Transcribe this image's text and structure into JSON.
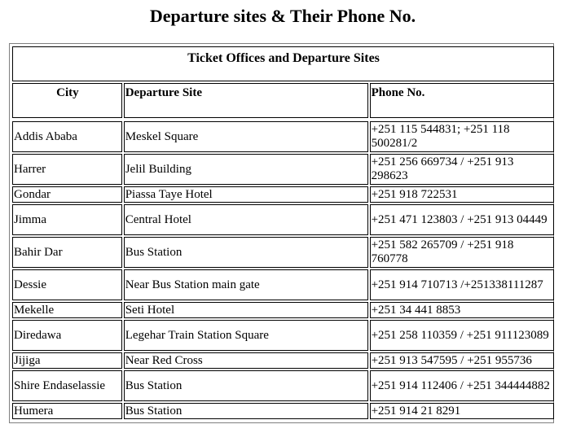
{
  "page": {
    "title": "Departure sites & Their Phone No."
  },
  "table": {
    "caption": "Ticket Offices and Departure Sites",
    "headers": {
      "city": "City",
      "site": "Departure Site",
      "phone": "Phone No."
    },
    "rows": [
      {
        "city": "Addis Ababa",
        "site": "Meskel Square",
        "phone": "+251 115 544831; +251 118 500281/2"
      },
      {
        "city": "Harrer",
        "site": "Jelil Building",
        "phone": "+251 256 669734 / +251 913 298623"
      },
      {
        "city": "Gondar",
        "site": "Piassa Taye Hotel",
        "phone": "+251 918 722531"
      },
      {
        "city": "Jimma",
        "site": "Central Hotel",
        "phone": "+251 471 123803 / +251 913 04449"
      },
      {
        "city": "Bahir Dar",
        "site": "Bus Station",
        "phone": "+251 582 265709 / +251 918 760778"
      },
      {
        "city": "Dessie",
        "site": "Near Bus Station main gate",
        "phone": "+251 914 710713 /+251338111287"
      },
      {
        "city": "Mekelle",
        "site": "Seti Hotel",
        "phone": "+251 34 441 8853"
      },
      {
        "city": "Diredawa",
        "site": "Legehar Train Station Square",
        "phone": "+251 258 110359 / +251 911123089"
      },
      {
        "city": "Jijiga",
        "site": "Near Red Cross",
        "phone": "+251 913 547595 / +251 955736"
      },
      {
        "city": "Shire Endaselassie",
        "site": "Bus Station",
        "phone": "+251 914 112406 / +251 344444882"
      },
      {
        "city": "Humera",
        "site": "Bus Station",
        "phone": "+251 914 21 8291"
      }
    ]
  }
}
